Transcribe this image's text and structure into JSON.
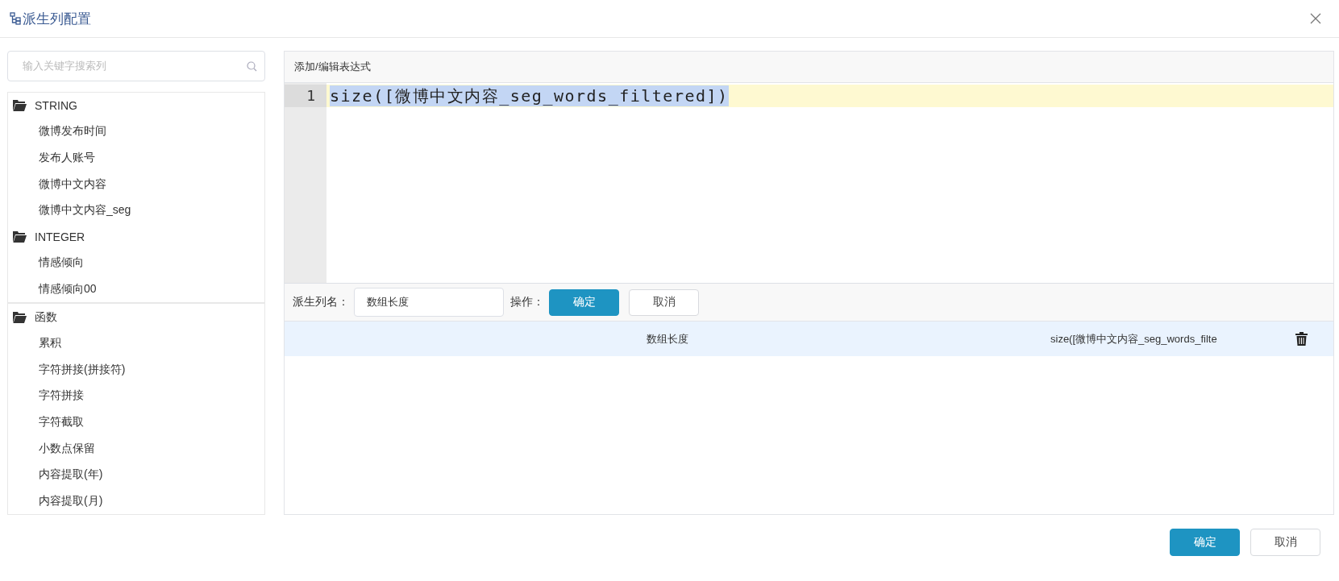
{
  "dialog": {
    "title": "派生列配置"
  },
  "search": {
    "placeholder": "输入关键字搜索列"
  },
  "column_tree": [
    {
      "label": "STRING",
      "children": [
        {
          "label": "微博发布时间"
        },
        {
          "label": "发布人账号"
        },
        {
          "label": "微博中文内容"
        },
        {
          "label": "微博中文内容_seg"
        }
      ]
    },
    {
      "label": "INTEGER",
      "children": [
        {
          "label": "情感倾向"
        },
        {
          "label": "情感倾向00"
        }
      ]
    }
  ],
  "function_tree": [
    {
      "label": "函数",
      "children": [
        {
          "label": "累积"
        },
        {
          "label": "字符拼接(拼接符)"
        },
        {
          "label": "字符拼接"
        },
        {
          "label": "字符截取"
        },
        {
          "label": "小数点保留"
        },
        {
          "label": "内容提取(年)"
        },
        {
          "label": "内容提取(月)"
        }
      ]
    }
  ],
  "editor": {
    "heading": "添加/编辑表达式",
    "lines": [
      {
        "number": "1",
        "text": "size([微博中文内容_seg_words_filtered])",
        "active": true,
        "selected": true
      }
    ]
  },
  "form": {
    "name_label": "派生列名：",
    "name_value": "数组长度",
    "action_label": "操作：",
    "confirm": "确定",
    "cancel": "取消"
  },
  "rows": [
    {
      "name": "数组长度",
      "expression": "size([微博中文内容_seg_words_filte",
      "selected": true
    }
  ],
  "footer": {
    "confirm": "确定",
    "cancel": "取消"
  }
}
